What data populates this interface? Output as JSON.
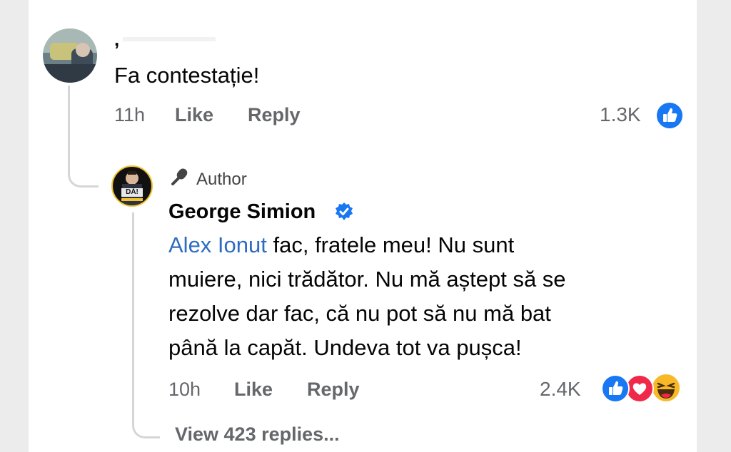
{
  "comment": {
    "author_name": ",",
    "text": "Fa contestație!",
    "time": "11h",
    "like_label": "Like",
    "reply_label": "Reply",
    "reaction_count": "1.3K",
    "reaction_icons": [
      "like-icon"
    ]
  },
  "reply": {
    "badge_label": "Author",
    "author_name": "George Simion",
    "verified": true,
    "avatar_text": "DĂ!",
    "mention": "Alex Ionut",
    "lines": [
      " fac, fratele meu! Nu sunt",
      "muiere, nici trădător. Nu mă aștept să se",
      "rezolve dar fac, că nu pot să nu mă bat",
      "până la capăt. Undeva tot va pușca!"
    ],
    "time": "10h",
    "like_label": "Like",
    "reply_label": "Reply",
    "reaction_count": "2.4K",
    "reaction_icons": [
      "like-icon",
      "love-icon",
      "haha-icon"
    ]
  },
  "view_replies_label": "View 423 replies...",
  "colors": {
    "accent": "#1877f2",
    "link": "#2d6cc0",
    "love": "#f0284a",
    "haha": "#f7b928",
    "meta": "#65676b"
  }
}
